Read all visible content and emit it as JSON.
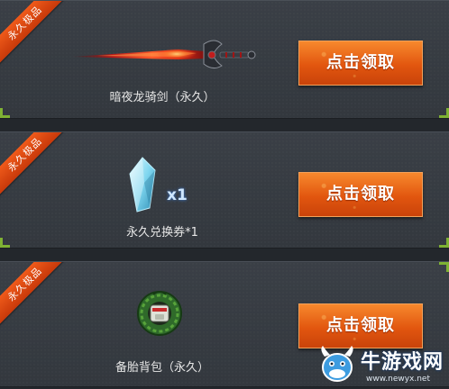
{
  "items": [
    {
      "ribbon": "永久极品",
      "label": "暗夜龙骑剑（永久）",
      "button": "点击领取",
      "icon": "sword-icon"
    },
    {
      "ribbon": "永久极品",
      "label": "永久兑换券*1",
      "button": "点击领取",
      "icon": "crystal-icon",
      "quantity": "x1"
    },
    {
      "ribbon": "永久极品",
      "label": "备胎背包（永久）",
      "button": "点击领取",
      "icon": "tire-backpack-icon"
    }
  ],
  "watermark": {
    "name": "牛游戏网",
    "url": "www.newyx.net"
  },
  "colors": {
    "panel": "#383d44",
    "ribbon": "#e0491a",
    "button": "#ee6a1c",
    "corner": "#7fb233"
  }
}
